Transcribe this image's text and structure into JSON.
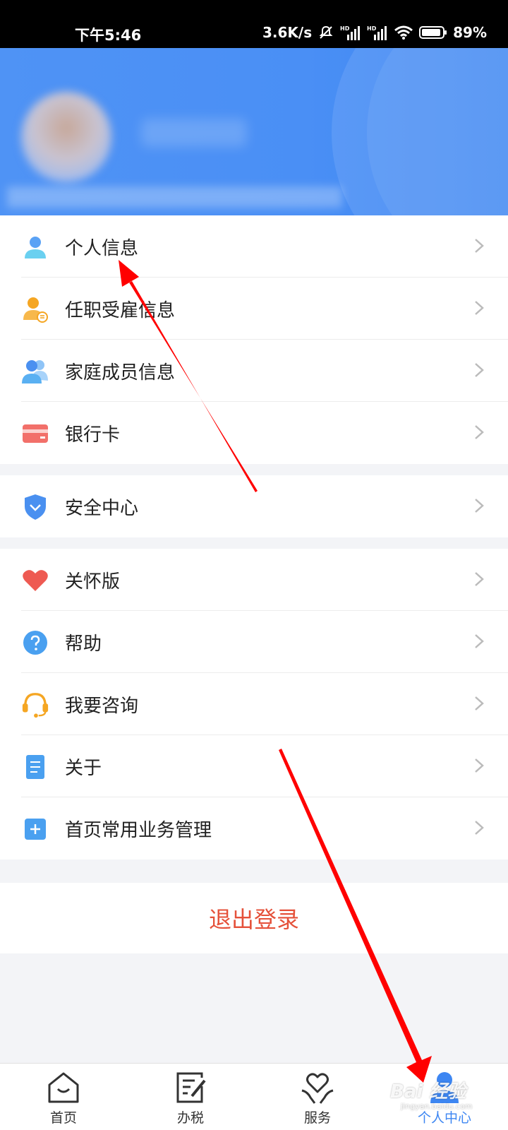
{
  "status_bar": {
    "time": "下午5:46",
    "speed": "3.6K/s",
    "battery": "89%"
  },
  "menu_group_1": [
    {
      "label": "个人信息",
      "icon": "user-icon"
    },
    {
      "label": "任职受雇信息",
      "icon": "employment-icon"
    },
    {
      "label": "家庭成员信息",
      "icon": "family-icon"
    },
    {
      "label": "银行卡",
      "icon": "bank-card-icon"
    }
  ],
  "menu_group_2": [
    {
      "label": "安全中心",
      "icon": "shield-icon"
    }
  ],
  "menu_group_3": [
    {
      "label": "关怀版",
      "icon": "heart-icon"
    },
    {
      "label": "帮助",
      "icon": "help-icon"
    },
    {
      "label": "我要咨询",
      "icon": "headset-icon"
    },
    {
      "label": "关于",
      "icon": "document-icon"
    },
    {
      "label": "首页常用业务管理",
      "icon": "plus-icon"
    }
  ],
  "logout_label": "退出登录",
  "tabs": [
    {
      "label": "首页",
      "icon": "home-icon"
    },
    {
      "label": "办税",
      "icon": "tax-edit-icon"
    },
    {
      "label": "服务",
      "icon": "service-heart-icon"
    },
    {
      "label": "个人中心",
      "icon": "profile-icon",
      "active": true
    }
  ],
  "watermark": {
    "text": "Bai 经验",
    "sub": "jingyan.baidu.com"
  },
  "colors": {
    "brand_blue": "#3d86f2",
    "logout_red": "#e5513a",
    "annotation_arrow": "#ff0000"
  }
}
